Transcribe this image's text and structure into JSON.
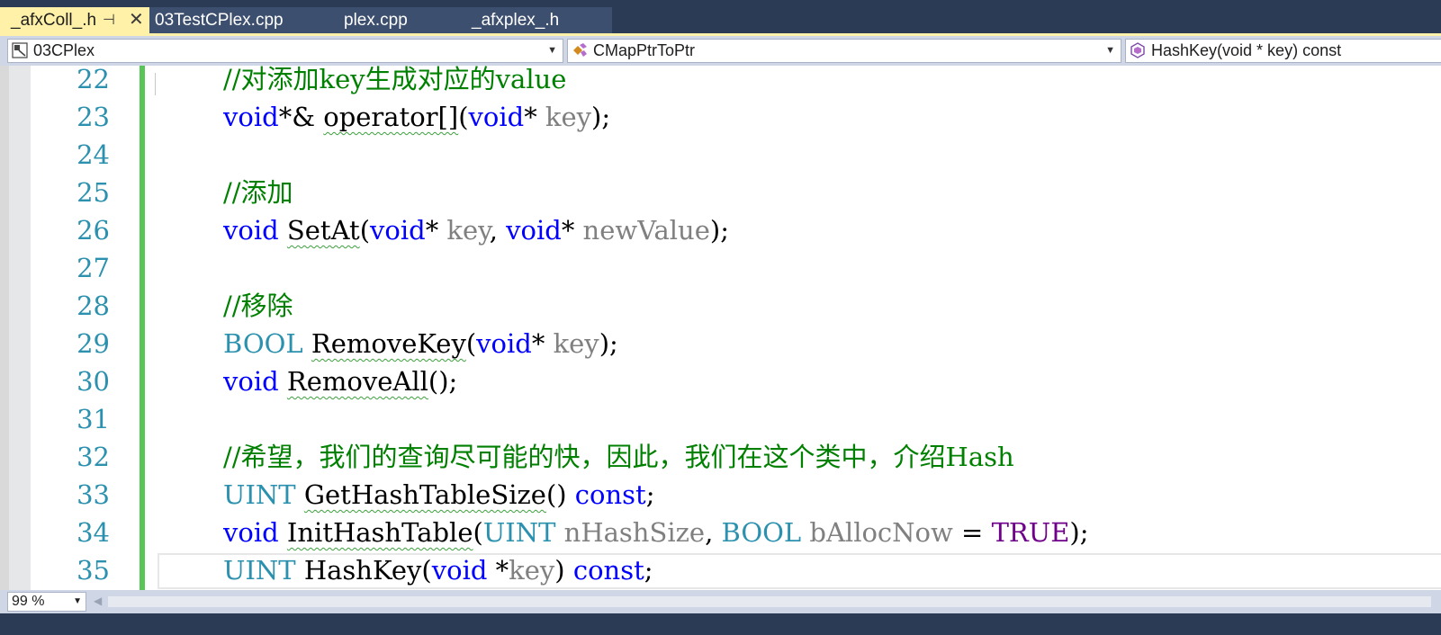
{
  "tabs": [
    {
      "label": "_afxColl_.h",
      "active": true
    },
    {
      "label": "03TestCPlex.cpp",
      "active": false
    },
    {
      "label": "plex.cpp",
      "active": false
    },
    {
      "label": "_afxplex_.h",
      "active": false
    }
  ],
  "tab_icons": {
    "pin": "pin-icon",
    "close": "close-icon"
  },
  "navbar": {
    "project": "03CPlex",
    "class": "CMapPtrToPtr",
    "member": "HashKey(void * key) const"
  },
  "code": {
    "line_numbers": [
      "22",
      "23",
      "24",
      "25",
      "26",
      "27",
      "28",
      "29",
      "30",
      "31",
      "32",
      "33",
      "34",
      "35"
    ],
    "l22": {
      "comment": "//对添加key生成对应的value"
    },
    "l23": {
      "t1": "void",
      "t2": "*& ",
      "t3": "operator[]",
      "t4": "(",
      "t5": "void",
      "t6": "* ",
      "t7": "key",
      "t8": ");"
    },
    "l25": {
      "comment": "//添加"
    },
    "l26": {
      "t1": "void",
      "t2": " ",
      "t3": "SetAt",
      "t4": "(",
      "t5": "void",
      "t6": "* ",
      "t7": "key",
      "t8": ", ",
      "t9": "void",
      "t10": "* ",
      "t11": "newValue",
      "t12": ");"
    },
    "l28": {
      "comment": "//移除"
    },
    "l29": {
      "t1": "BOOL",
      "t2": " ",
      "t3": "RemoveKey",
      "t4": "(",
      "t5": "void",
      "t6": "* ",
      "t7": "key",
      "t8": ");"
    },
    "l30": {
      "t1": "void",
      "t2": " ",
      "t3": "RemoveAll",
      "t4": "();"
    },
    "l32": {
      "comment": "//希望，我们的查询尽可能的快，因此，我们在这个类中，介绍Hash"
    },
    "l33": {
      "t1": "UINT",
      "t2": " ",
      "t3": "GetHashTableSize",
      "t4": "() ",
      "t5": "const",
      "t6": ";"
    },
    "l34": {
      "t1": "void",
      "t2": " ",
      "t3": "InitHashTable",
      "t4": "(",
      "t5": "UINT",
      "t6": " ",
      "t7": "nHashSize",
      "t8": ", ",
      "t9": "BOOL",
      "t10": " ",
      "t11": "bAllocNow",
      "t12": " = ",
      "t13": "TRUE",
      "t14": ");"
    },
    "l35": {
      "t1": "UINT",
      "t2": " ",
      "t3": "HashKey",
      "t4": "(",
      "t5": "void",
      "t6": " *",
      "t7": "key",
      "t8": ") ",
      "t9": "const",
      "t10": ";"
    }
  },
  "zoom": "99 %",
  "colors": {
    "accent_tab": "#fff1a8",
    "keyword": "#0000ff",
    "type": "#2b91af",
    "comment": "#008000",
    "param": "#808080",
    "macro": "#6f008a",
    "change_bar": "#57c657"
  }
}
